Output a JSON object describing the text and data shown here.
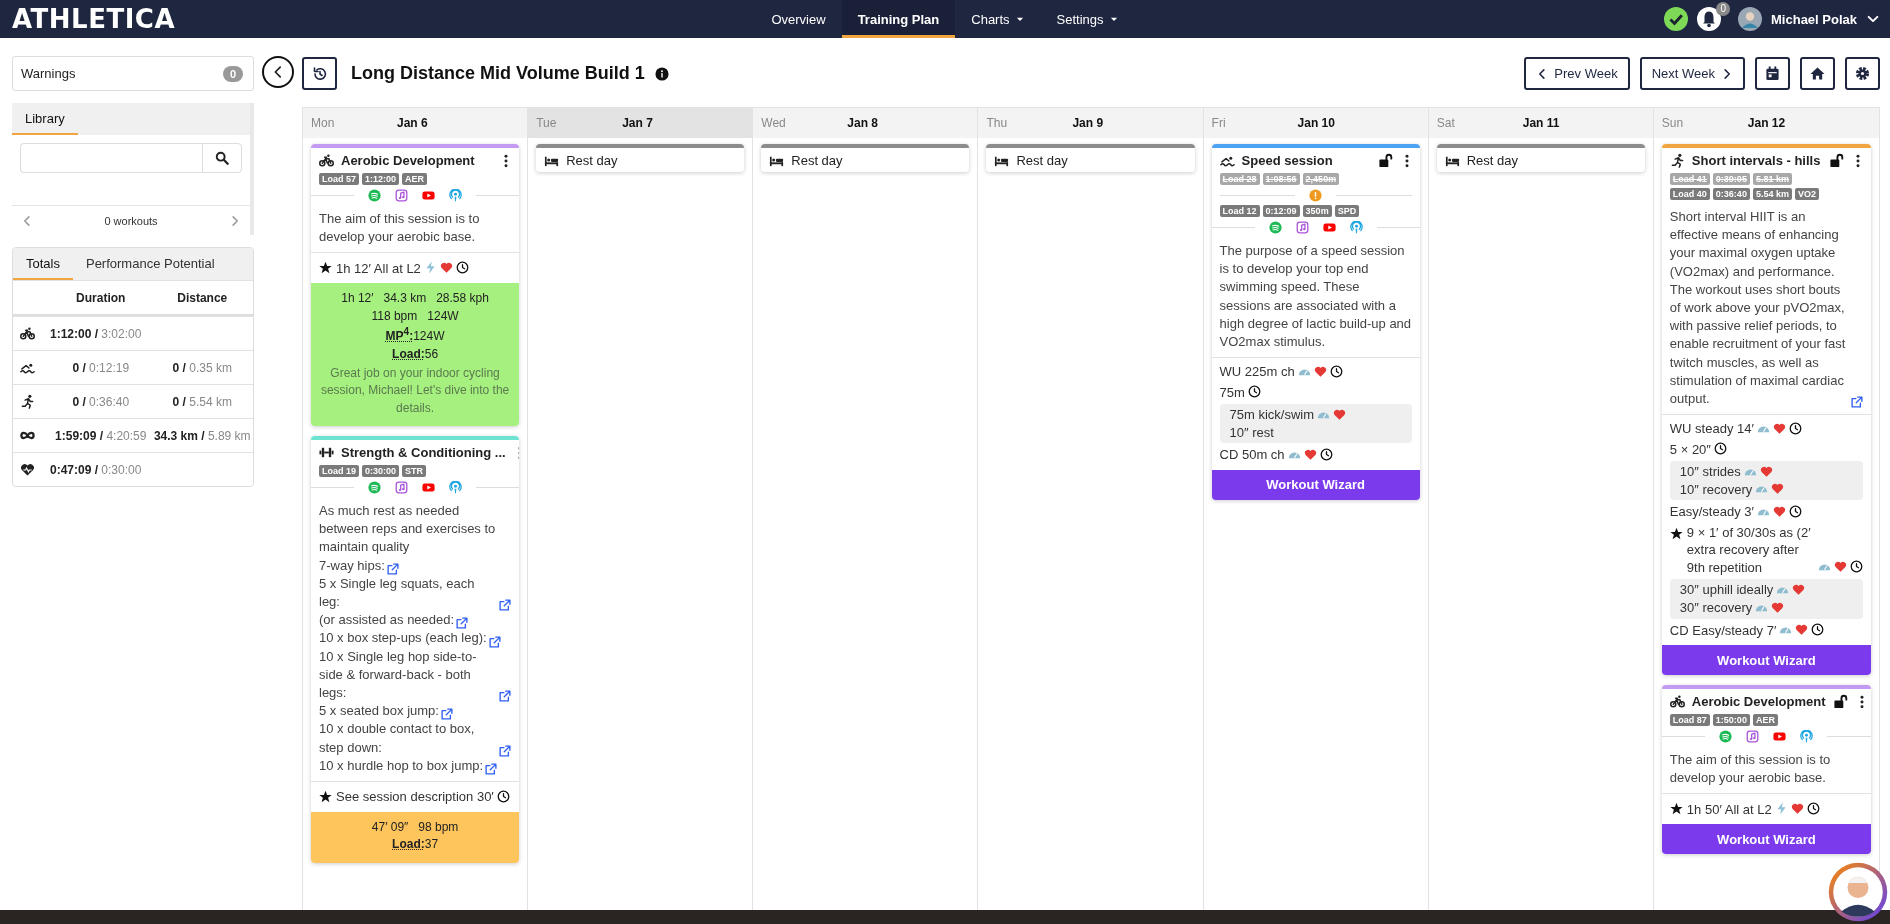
{
  "nav": {
    "logo": "ATHLETICA",
    "menu": [
      {
        "label": "Overview",
        "selected": false,
        "caret": false
      },
      {
        "label": "Training Plan",
        "selected": true,
        "caret": false
      },
      {
        "label": "Charts",
        "selected": false,
        "caret": true
      },
      {
        "label": "Settings",
        "selected": false,
        "caret": true
      }
    ],
    "notifications": "0",
    "user": "Michael Polak"
  },
  "sidebar": {
    "warnings": {
      "label": "Warnings",
      "count": "0"
    },
    "library": {
      "tab": "Library",
      "pager": "0 workouts"
    },
    "totals": {
      "tabs": [
        {
          "label": "Totals",
          "selected": true
        },
        {
          "label": "Performance Potential",
          "selected": false
        }
      ],
      "columns": [
        "Duration",
        "Distance"
      ],
      "rows": [
        {
          "kind": "bike",
          "duration": "**1:12:00 /** 3:02:00"
        },
        {
          "kind": "swim",
          "duration": "**0 /** 0:12:19",
          "distance": "**0 /** 0.35 km"
        },
        {
          "kind": "run",
          "duration": "**0 /** 0:36:40",
          "distance": "**0 /** 5.54 km"
        },
        {
          "kind": "total",
          "duration": "**1:59:09 /** 4:20:59",
          "distance": "**34.3 km /** 5.89 km"
        },
        {
          "kind": "heart",
          "duration": "**0:47:09 /** 0:30:00"
        }
      ]
    }
  },
  "plan": {
    "title": "Long Distance Mid Volume Build 1",
    "prev": "Prev Week",
    "next": "Next Week"
  },
  "days": [
    {
      "day": "Mon",
      "date": "Jan 6",
      "highlighted": false,
      "workouts": [
        {
          "kind": "bike",
          "color": "#c39bf2",
          "title": "Aerobic Development",
          "lock": false,
          "warning": false,
          "tags": [
            "Load 57",
            "1:12:00",
            "AER"
          ],
          "media": true,
          "description": [
            {
              "text": "The aim of this session is to develop your aerobic base.",
              "link": false
            }
          ],
          "steps": [
            {
              "kind": "step",
              "star": true,
              "text": "1h 12′ All at L2",
              "power": true,
              "pace": false,
              "heart": true,
              "clock": true
            }
          ],
          "result": {
            "color": "#a6f07f",
            "stats": [
              "1h 12′",
              "34.3 km",
              "28.58 kph",
              "118 bpm",
              "124W"
            ],
            "metrics": [
              {
                "label": "MP$^{4}$:",
                "value": "124W"
              },
              {
                "label": "Load:",
                "value": "56"
              }
            ],
            "message": "Great job on your indoor cycling session, Michael! Let's dive into the details."
          }
        },
        {
          "kind": "strength",
          "color": "#6fe3d1",
          "title": "Strength & Conditioning ...",
          "lock": false,
          "warning": false,
          "tags": [
            "Load 19",
            "0:30:00",
            "STR"
          ],
          "media": true,
          "description": [
            {
              "text": "As much rest as needed between reps and exercises to maintain quality",
              "link": false
            },
            {
              "text": "7-way hips:",
              "link": true
            },
            {
              "text": "5 x Single leg squats, each leg:",
              "link": true
            },
            {
              "text": "(or assisted as needed:",
              "link": true
            },
            {
              "text": "10 x box step-ups (each leg):",
              "link": true
            },
            {
              "text": "10 x Single leg hop side-to-side & forward-back - both legs:",
              "link": true
            },
            {
              "text": "5 x seated box jump:",
              "link": true
            },
            {
              "text": "10 x double contact to box, step down:",
              "link": true
            },
            {
              "text": "10 x hurdle hop to box jump:",
              "link": true
            }
          ],
          "steps": [
            {
              "kind": "step",
              "star": true,
              "text": "See session description 30′",
              "power": false,
              "pace": false,
              "heart": false,
              "clock": true
            }
          ],
          "result": {
            "color": "#fec55d",
            "stats": [
              "47′ 09″",
              "98 bpm"
            ],
            "metrics": [
              {
                "label": "Load:",
                "value": "37"
              }
            ]
          }
        }
      ]
    },
    {
      "day": "Tue",
      "date": "Jan 7",
      "highlighted": true,
      "workouts": [
        {
          "kind": "rest",
          "color": "#8c8c8c",
          "title": "Rest day"
        }
      ]
    },
    {
      "day": "Wed",
      "date": "Jan 8",
      "highlighted": false,
      "workouts": [
        {
          "kind": "rest",
          "color": "#8c8c8c",
          "title": "Rest day"
        }
      ]
    },
    {
      "day": "Thu",
      "date": "Jan 9",
      "highlighted": false,
      "workouts": [
        {
          "kind": "rest",
          "color": "#8c8c8c",
          "title": "Rest day"
        }
      ]
    },
    {
      "day": "Fri",
      "date": "Jan 10",
      "highlighted": false,
      "workouts": [
        {
          "kind": "swim",
          "color": "#4da3f2",
          "title": "Speed session",
          "lock": true,
          "old_tags": [
            "Load 28",
            "1:08:56",
            "2,450m"
          ],
          "warning": true,
          "tags": [
            "Load 12",
            "0:12:09",
            "350m",
            "SPD"
          ],
          "media": true,
          "description": [
            {
              "text": "The purpose of a speed session is to develop your top end swimming speed. These sessions are associated with a high degree of lactic build-up and VO2max stimulus.",
              "link": false
            }
          ],
          "steps": [
            {
              "kind": "step",
              "star": false,
              "text": "WU 225m ch",
              "power": false,
              "pace": true,
              "heart": true,
              "clock": true
            },
            {
              "kind": "step",
              "star": false,
              "text": "75m",
              "power": false,
              "pace": false,
              "heart": false,
              "clock": true
            },
            {
              "kind": "group",
              "lines": [
                {
                  "text": "75m kick/swim",
                  "pace": true,
                  "heart": true
                },
                {
                  "text": "10″ rest",
                  "pace": false,
                  "heart": false
                }
              ]
            },
            {
              "kind": "step",
              "star": false,
              "text": "CD 50m ch",
              "power": false,
              "pace": true,
              "heart": true,
              "clock": true
            }
          ],
          "wizard": "Workout Wizard"
        }
      ]
    },
    {
      "day": "Sat",
      "date": "Jan 11",
      "highlighted": false,
      "workouts": [
        {
          "kind": "rest",
          "color": "#8c8c8c",
          "title": "Rest day"
        }
      ]
    },
    {
      "day": "Sun",
      "date": "Jan 12",
      "highlighted": false,
      "workouts": [
        {
          "kind": "run",
          "color": "#f0a540",
          "title": "Short intervals - hills",
          "lock": true,
          "old_tags": [
            "Load 41",
            "0:39:05",
            "5.81 km"
          ],
          "warning": false,
          "tags": [
            "Load 40",
            "0:36:40",
            "5.54 km",
            "VO2"
          ],
          "media": false,
          "description": [
            {
              "text": "Short interval HIIT is an effective means of enhancing your maximal oxygen uptake (VO2max) and performance. The workout uses short bouts of work above your pVO2max, with passive relief periods, to enable recruitment of your fast twitch muscles, as well as stimulation of maximal cardiac output.",
              "link": true
            }
          ],
          "steps": [
            {
              "kind": "step",
              "star": false,
              "text": "WU steady 14′",
              "power": false,
              "pace": true,
              "heart": true,
              "clock": true
            },
            {
              "kind": "step",
              "star": false,
              "text": "5 × 20″",
              "power": false,
              "pace": false,
              "heart": false,
              "clock": true
            },
            {
              "kind": "group",
              "lines": [
                {
                  "text": "10″ strides",
                  "pace": true,
                  "heart": true
                },
                {
                  "text": "10″ recovery",
                  "pace": true,
                  "heart": true
                }
              ]
            },
            {
              "kind": "step",
              "star": false,
              "text": "Easy/steady 3′",
              "power": false,
              "pace": true,
              "heart": true,
              "clock": true
            },
            {
              "kind": "step",
              "star": true,
              "text": "9 × 1′ of 30/30s as (2′ extra recovery after 9th repetition",
              "power": false,
              "pace": true,
              "heart": true,
              "clock": true
            },
            {
              "kind": "group",
              "lines": [
                {
                  "text": "30″ uphill ideally",
                  "pace": true,
                  "heart": true
                },
                {
                  "text": "30″ recovery",
                  "pace": true,
                  "heart": true
                }
              ]
            },
            {
              "kind": "step",
              "star": false,
              "text": "CD Easy/steady 7′",
              "power": false,
              "pace": true,
              "heart": true,
              "clock": true
            }
          ],
          "wizard": "Workout Wizard"
        },
        {
          "kind": "bike",
          "color": "#c39bf2",
          "title": "Aerobic Development",
          "lock": true,
          "warning": false,
          "tags": [
            "Load 87",
            "1:50:00",
            "AER"
          ],
          "media": true,
          "description": [
            {
              "text": "The aim of this session is to develop your aerobic base.",
              "link": false
            }
          ],
          "steps": [
            {
              "kind": "step",
              "star": true,
              "text": "1h 50′ All at L2",
              "power": true,
              "pace": false,
              "heart": true,
              "clock": true
            }
          ],
          "wizard": "Workout Wizard"
        }
      ]
    }
  ]
}
